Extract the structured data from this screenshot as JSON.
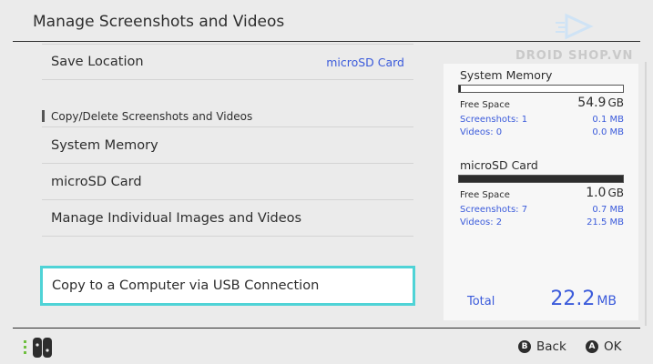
{
  "header": {
    "title": "Manage Screenshots and Videos"
  },
  "watermark": {
    "text": "DROID SHOP.VN"
  },
  "menu": {
    "save_location": {
      "label": "Save Location",
      "value": "microSD Card"
    },
    "section_header": "Copy/Delete Screenshots and Videos",
    "items": [
      {
        "label": "System Memory"
      },
      {
        "label": "microSD Card"
      },
      {
        "label": "Manage Individual Images and Videos"
      }
    ],
    "selected_item": {
      "label": "Copy to a Computer via USB Connection"
    }
  },
  "panel": {
    "system_memory": {
      "heading": "System Memory",
      "fill_fraction": 0.01,
      "free_space_label": "Free Space",
      "free_space_value": "54.9",
      "free_space_unit": "GB",
      "screenshots_label": "Screenshots: 1",
      "screenshots_size": "0.1 MB",
      "videos_label": "Videos: 0",
      "videos_size": "0.0 MB"
    },
    "microsd": {
      "heading": "microSD Card",
      "fill_fraction": 1.0,
      "free_space_label": "Free Space",
      "free_space_value": "1.0",
      "free_space_unit": "GB",
      "screenshots_label": "Screenshots: 7",
      "screenshots_size": "0.7 MB",
      "videos_label": "Videos: 2",
      "videos_size": "21.5 MB"
    },
    "total_label": "Total",
    "total_value": "22.2",
    "total_unit": "MB"
  },
  "footer": {
    "back": {
      "glyph": "B",
      "label": "Back"
    },
    "ok": {
      "glyph": "A",
      "label": "OK"
    }
  },
  "colors": {
    "accent_blue": "#3b5bdb",
    "selection_cyan": "#4fd3d6",
    "background": "#ebebeb"
  },
  "icons": [
    "droidshop-logo-icon",
    "joycon-controller-icon"
  ]
}
